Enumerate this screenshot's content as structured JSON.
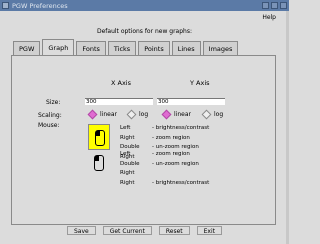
{
  "window": {
    "title": "PGW Preferences"
  },
  "menu": {
    "help_label": "Help"
  },
  "header": {
    "text": "Default options for new graphs:"
  },
  "tabs": [
    {
      "label": "PGW",
      "active": false
    },
    {
      "label": "Graph",
      "active": true
    },
    {
      "label": "Fonts",
      "active": false
    },
    {
      "label": "Ticks",
      "active": false
    },
    {
      "label": "Points",
      "active": false
    },
    {
      "label": "Lines",
      "active": false
    },
    {
      "label": "Images",
      "active": false
    }
  ],
  "graph": {
    "x_axis_header": "X Axis",
    "y_axis_header": "Y Axis",
    "size_label": "Size:",
    "x_size_value": "300",
    "y_size_value": "300",
    "scaling_label": "Scaling:",
    "x_scaling": {
      "linear_label": "linear",
      "log_label": "log",
      "selected": "linear"
    },
    "y_scaling": {
      "linear_label": "linear",
      "log_label": "log",
      "selected": "linear"
    },
    "mouse_label": "Mouse:",
    "mouse_mode1": [
      {
        "button": "Left",
        "action": "brightness/contrast"
      },
      {
        "button": "Right",
        "action": "zoom region"
      },
      {
        "button": "Double Right",
        "action": "un-zoom region"
      }
    ],
    "mouse_mode2": [
      {
        "button": "Left",
        "action": "zoom region"
      },
      {
        "button": "Double Right",
        "action": "un-zoom region"
      },
      {
        "button": "Right",
        "action": "brightness/contrast"
      }
    ]
  },
  "buttons": {
    "save": "Save",
    "get_current": "Get Current",
    "reset": "Reset",
    "exit": "Exit"
  },
  "colors": {
    "titlebar": "#5b7aa6",
    "radio_selected": "#e06bd2",
    "mouse_mode_highlight": "#ffff00"
  }
}
